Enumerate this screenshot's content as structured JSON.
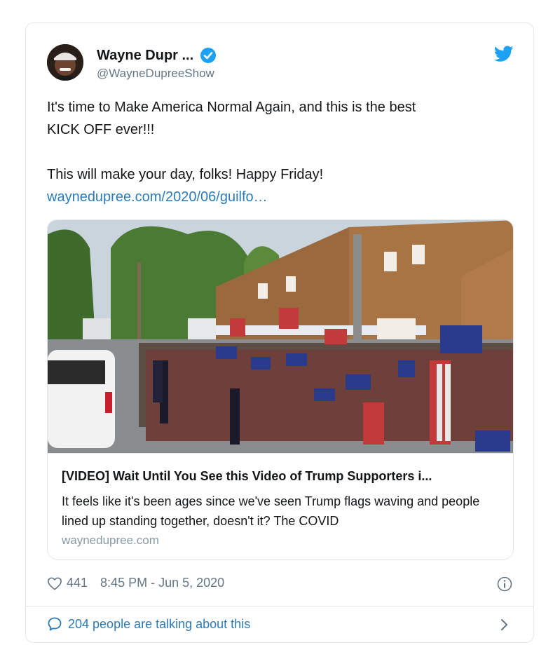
{
  "author": {
    "name": "Wayne Dupr ...",
    "handle": "@WayneDupreeShow",
    "verified": true
  },
  "tweet": {
    "line1": "It's time to Make America Normal Again, and this is the best",
    "line2": "KICK OFF ever!!!",
    "line3": "This will make your day, folks! Happy Friday!",
    "link": "waynedupree.com/2020/06/guilfo…"
  },
  "link_card": {
    "title": "[VIDEO] Wait Until You See this Video of Trump Supporters i...",
    "description": "It feels like it's been ages since we've seen Trump flags waving and people lined up standing together, doesn't it? The COVID",
    "domain": "waynedupree.com"
  },
  "meta": {
    "likes": "441",
    "timestamp": "8:45 PM - Jun 5, 2020"
  },
  "conversation": {
    "label": "204 people are talking about this"
  },
  "colors": {
    "accent": "#1DA1F2",
    "link": "#2B7BB9",
    "muted": "#657786",
    "border": "#E1E8ED"
  },
  "icons": [
    "verified-badge-icon",
    "twitter-bird-icon",
    "heart-icon",
    "info-icon",
    "speech-bubble-icon",
    "chevron-right-icon"
  ]
}
